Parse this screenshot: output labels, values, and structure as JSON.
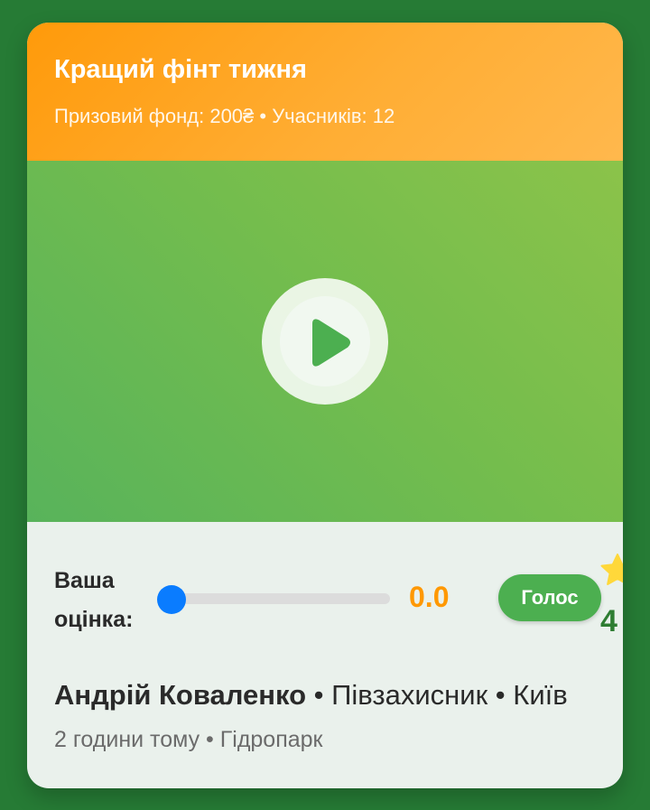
{
  "header": {
    "title": "Кращий фінт тижня",
    "subtitle": "Призовий фонд: 200₴ • Учасників: 12"
  },
  "video": {
    "play_icon": "play-icon"
  },
  "rating": {
    "label": "Ваша оцінка:",
    "value": "0.0",
    "slider_level": 0,
    "vote_label": "Голос",
    "star_icon": "star-icon",
    "star_count": "4"
  },
  "author": {
    "name": "Андрій Коваленко",
    "details": " • Півзахисник • Київ"
  },
  "meta": {
    "text": "2 години тому • Гідропарк"
  },
  "colors": {
    "background": "#267b35",
    "header_accent": "#ff9a0a",
    "video_green": "#74bd4d",
    "slider_thumb": "#0a7cff",
    "rating_value": "#ff9800",
    "vote_button": "#4caf50",
    "star_count": "#2e7d32"
  }
}
